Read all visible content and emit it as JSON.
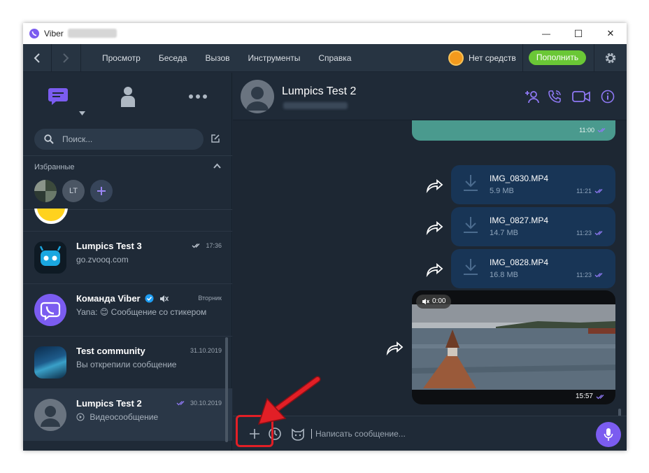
{
  "window": {
    "title": "Viber",
    "controls": {
      "minimize": "—",
      "maximize": "☐",
      "close": "✕"
    }
  },
  "toolbar": {
    "menu": [
      "Просмотр",
      "Беседа",
      "Вызов",
      "Инструменты",
      "Справка"
    ],
    "balance_label": "Нет средств",
    "topup_label": "Пополнить"
  },
  "sidebar": {
    "search_placeholder": "Поиск...",
    "favorites_title": "Избранные",
    "favorites": [
      {
        "type": "photo"
      },
      {
        "type": "initials",
        "text": "LT"
      },
      {
        "type": "add"
      }
    ],
    "chats": [
      {
        "name": "Lumpics Test 3",
        "preview": "go.zvooq.com",
        "time": "17:36",
        "status": "read"
      },
      {
        "name": "Команда Viber",
        "preview": "Yana: 😊 Сообщение со стикером",
        "time": "Вторник",
        "verified": true,
        "muted": true
      },
      {
        "name": "Test community",
        "preview": "Вы открепили сообщение",
        "time": "31.10.2019"
      },
      {
        "name": "Lumpics Test 2",
        "preview": "Видеосообщение",
        "time": "30.10.2019",
        "status": "read",
        "active": true
      }
    ]
  },
  "chat": {
    "title": "Lumpics Test 2",
    "messages": [
      {
        "type": "image-cut",
        "time": "11:00"
      },
      {
        "type": "file",
        "name": "IMG_0830.MP4",
        "size": "5.9 MB",
        "time": "11:21"
      },
      {
        "type": "file",
        "name": "IMG_0827.MP4",
        "size": "14.7 MB",
        "time": "11:23"
      },
      {
        "type": "file",
        "name": "IMG_0828.MP4",
        "size": "16.8 MB",
        "time": "11:23"
      },
      {
        "type": "video",
        "duration": "0:00",
        "time": "15:57"
      }
    ],
    "input_placeholder": "Написать сообщение..."
  },
  "colors": {
    "accent": "#7b5cf0",
    "topup": "#6ac736",
    "annotation": "#e21f26"
  }
}
